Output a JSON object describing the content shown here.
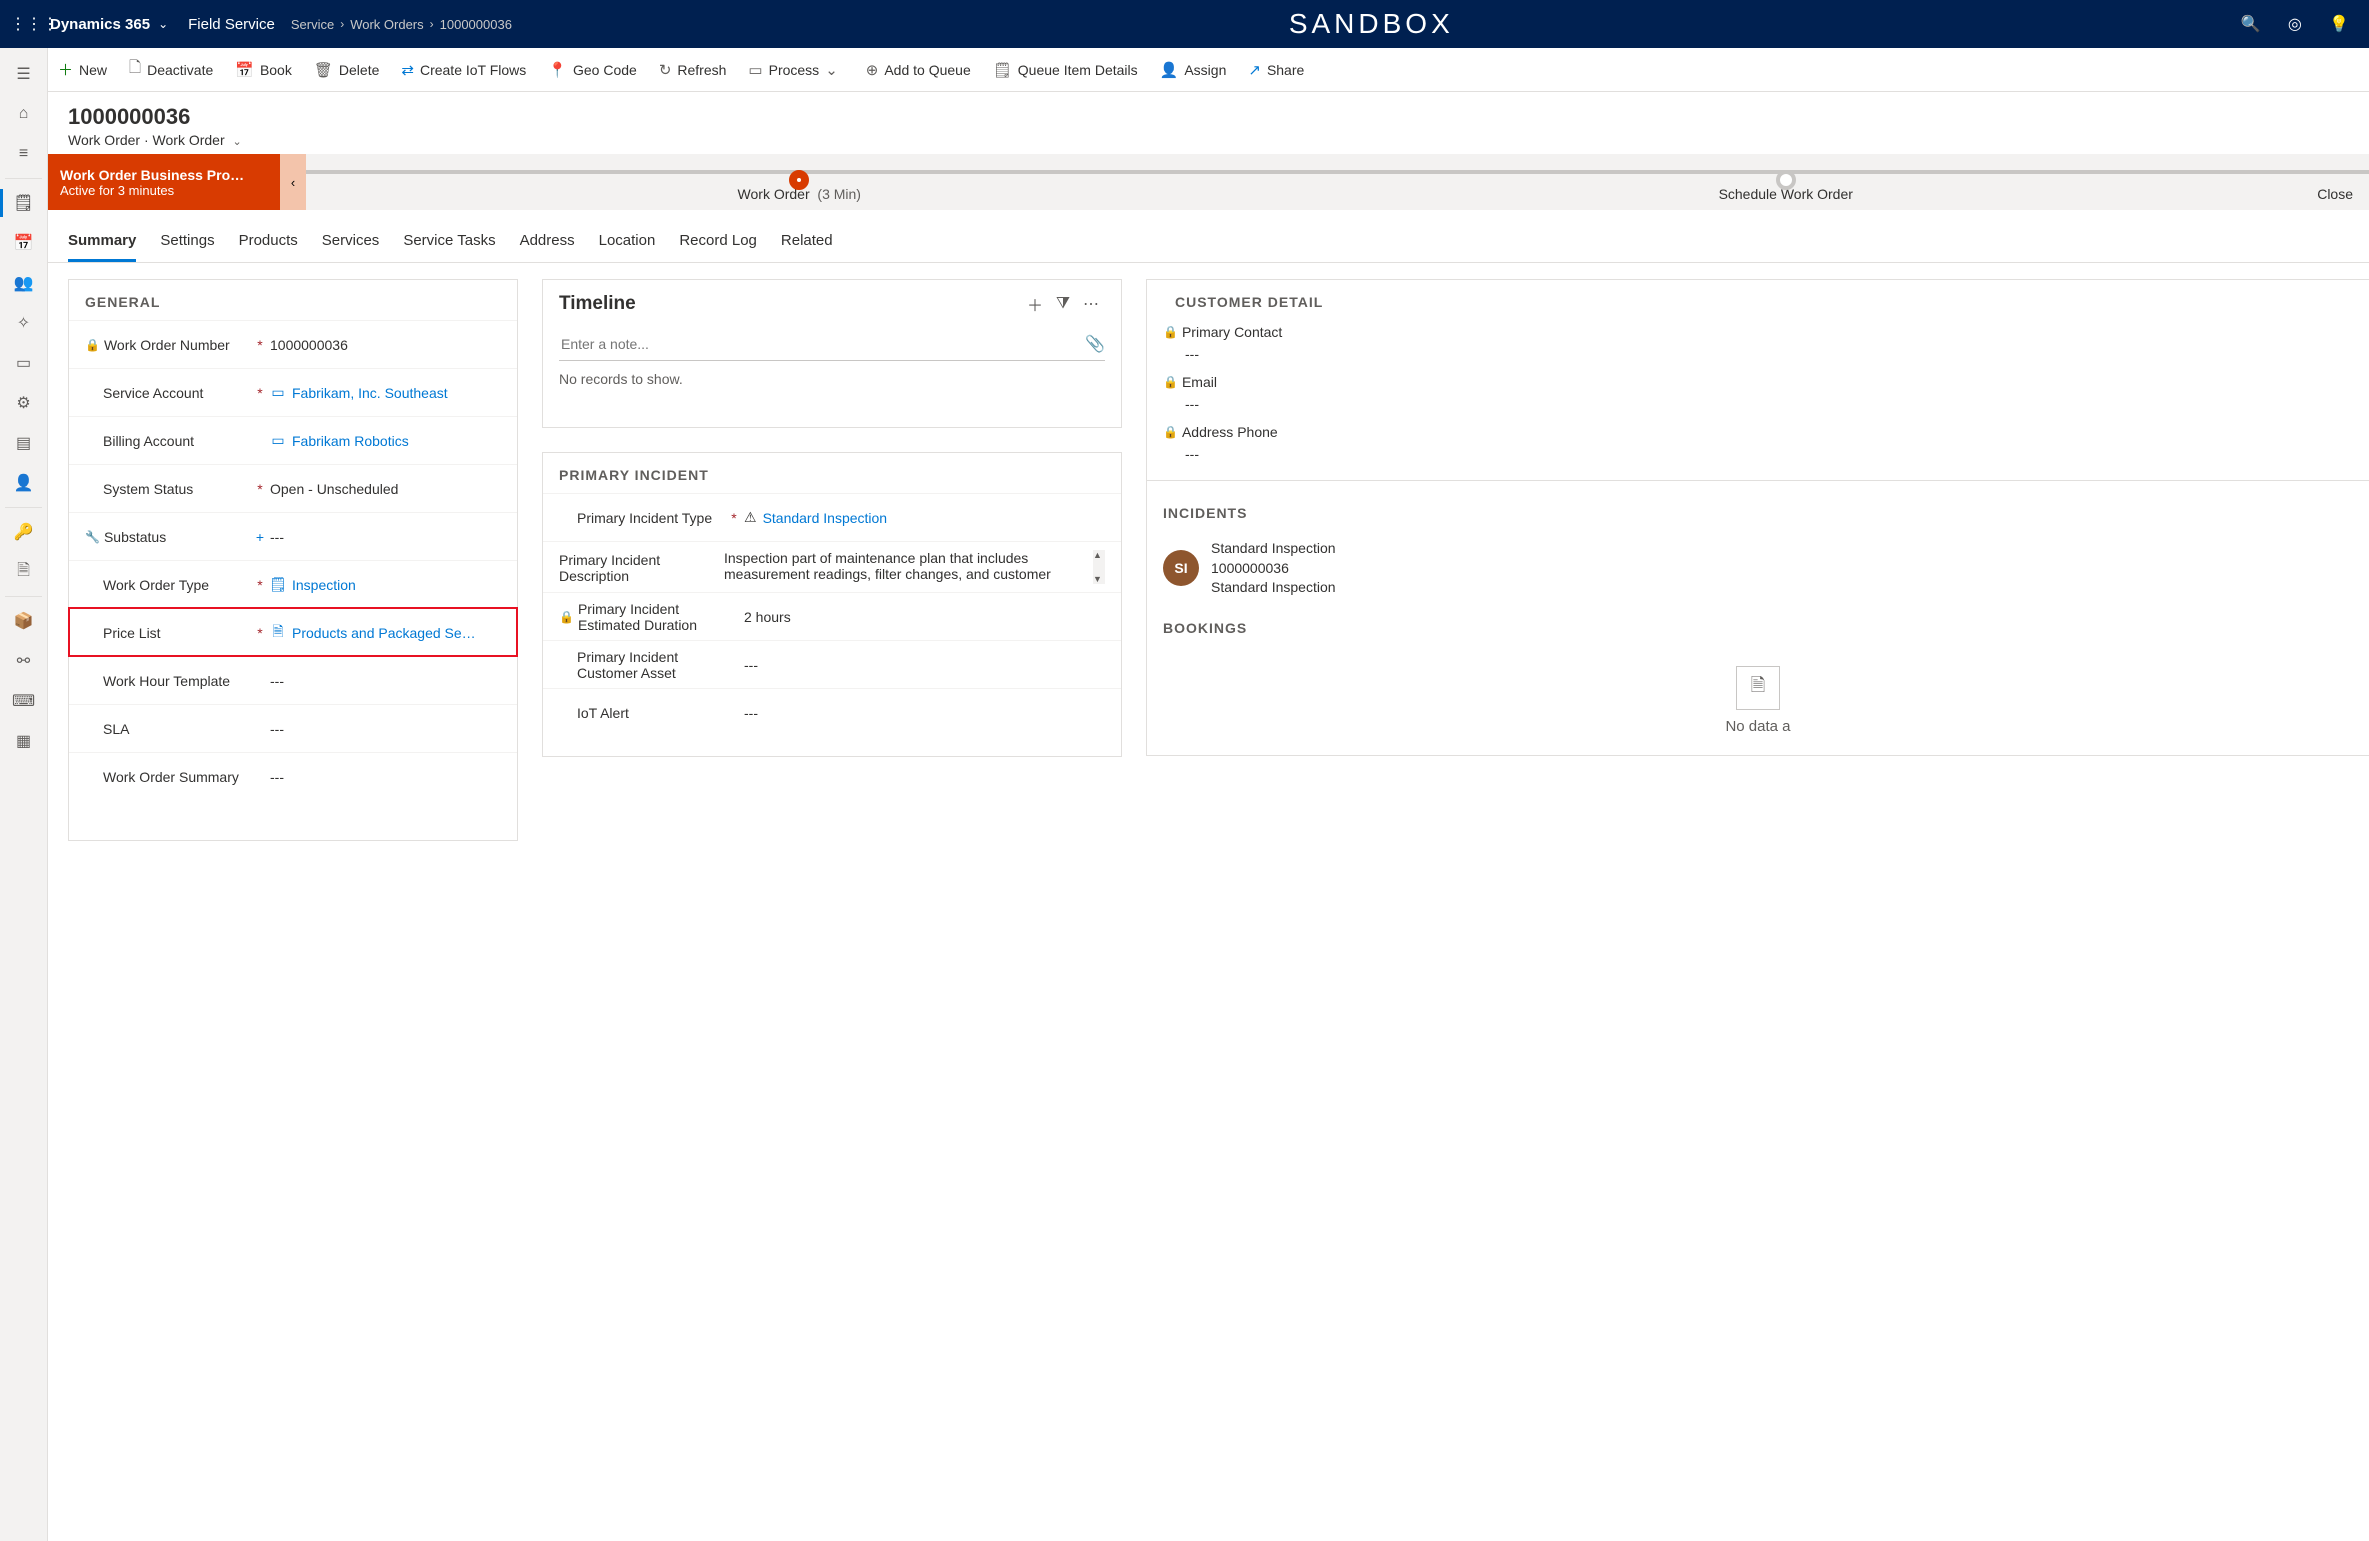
{
  "banner": {
    "brand": "Dynamics 365",
    "area": "Field Service",
    "breadcrumb": [
      "Service",
      "Work Orders",
      "1000000036"
    ],
    "center": "SANDBOX"
  },
  "commands": {
    "new": "New",
    "deactivate": "Deactivate",
    "book": "Book",
    "delete": "Delete",
    "iot": "Create IoT Flows",
    "geo": "Geo Code",
    "refresh": "Refresh",
    "process": "Process",
    "queue": "Add to Queue",
    "queuedet": "Queue Item Details",
    "assign": "Assign",
    "share": "Share"
  },
  "record": {
    "title": "1000000036",
    "entity": "Work Order",
    "form": "Work Order"
  },
  "bpf": {
    "name": "Work Order Business Pro…",
    "status": "Active for 3 minutes",
    "stages": [
      {
        "label": "Work Order",
        "duration": "(3 Min)",
        "active": true
      },
      {
        "label": "Schedule Work Order",
        "duration": "",
        "active": false
      },
      {
        "label": "Close",
        "duration": "",
        "active": false,
        "edge": true
      }
    ]
  },
  "tabs": [
    "Summary",
    "Settings",
    "Products",
    "Services",
    "Service Tasks",
    "Address",
    "Location",
    "Record Log",
    "Related"
  ],
  "general": {
    "title": "GENERAL",
    "fields": {
      "won_label": "Work Order Number",
      "won_value": "1000000036",
      "sa_label": "Service Account",
      "sa_value": "Fabrikam, Inc. Southeast",
      "ba_label": "Billing Account",
      "ba_value": "Fabrikam Robotics",
      "ss_label": "System Status",
      "ss_value": "Open - Unscheduled",
      "sub_label": "Substatus",
      "sub_value": "---",
      "wot_label": "Work Order Type",
      "wot_value": "Inspection",
      "pl_label": "Price List",
      "pl_value": "Products and Packaged Se…",
      "wht_label": "Work Hour Template",
      "wht_value": "---",
      "sla_label": "SLA",
      "sla_value": "---",
      "wos_label": "Work Order Summary",
      "wos_value": "---"
    }
  },
  "timeline": {
    "title": "Timeline",
    "placeholder": "Enter a note...",
    "empty": "No records to show."
  },
  "primary_incident": {
    "title": "PRIMARY INCIDENT",
    "type_label": "Primary Incident Type",
    "type_value": "Standard Inspection",
    "desc_label": "Primary Incident Description",
    "desc_value": "Inspection part of maintenance plan that includes measurement readings, filter changes, and customer",
    "dur_label": "Primary Incident Estimated Duration",
    "dur_value": "2 hours",
    "asset_label": "Primary Incident Customer Asset",
    "asset_value": "---",
    "iot_label": "IoT Alert",
    "iot_value": "---"
  },
  "customer": {
    "title": "CUSTOMER DETAIL",
    "pc_label": "Primary Contact",
    "pc_value": "---",
    "em_label": "Email",
    "em_value": "---",
    "ap_label": "Address Phone",
    "ap_value": "---"
  },
  "incidents": {
    "title": "INCIDENTS",
    "item": {
      "initials": "SI",
      "line1": "Standard Inspection",
      "line2": "1000000036",
      "line3": "Standard Inspection"
    }
  },
  "bookings": {
    "title": "BOOKINGS",
    "nodata": "No data a"
  }
}
